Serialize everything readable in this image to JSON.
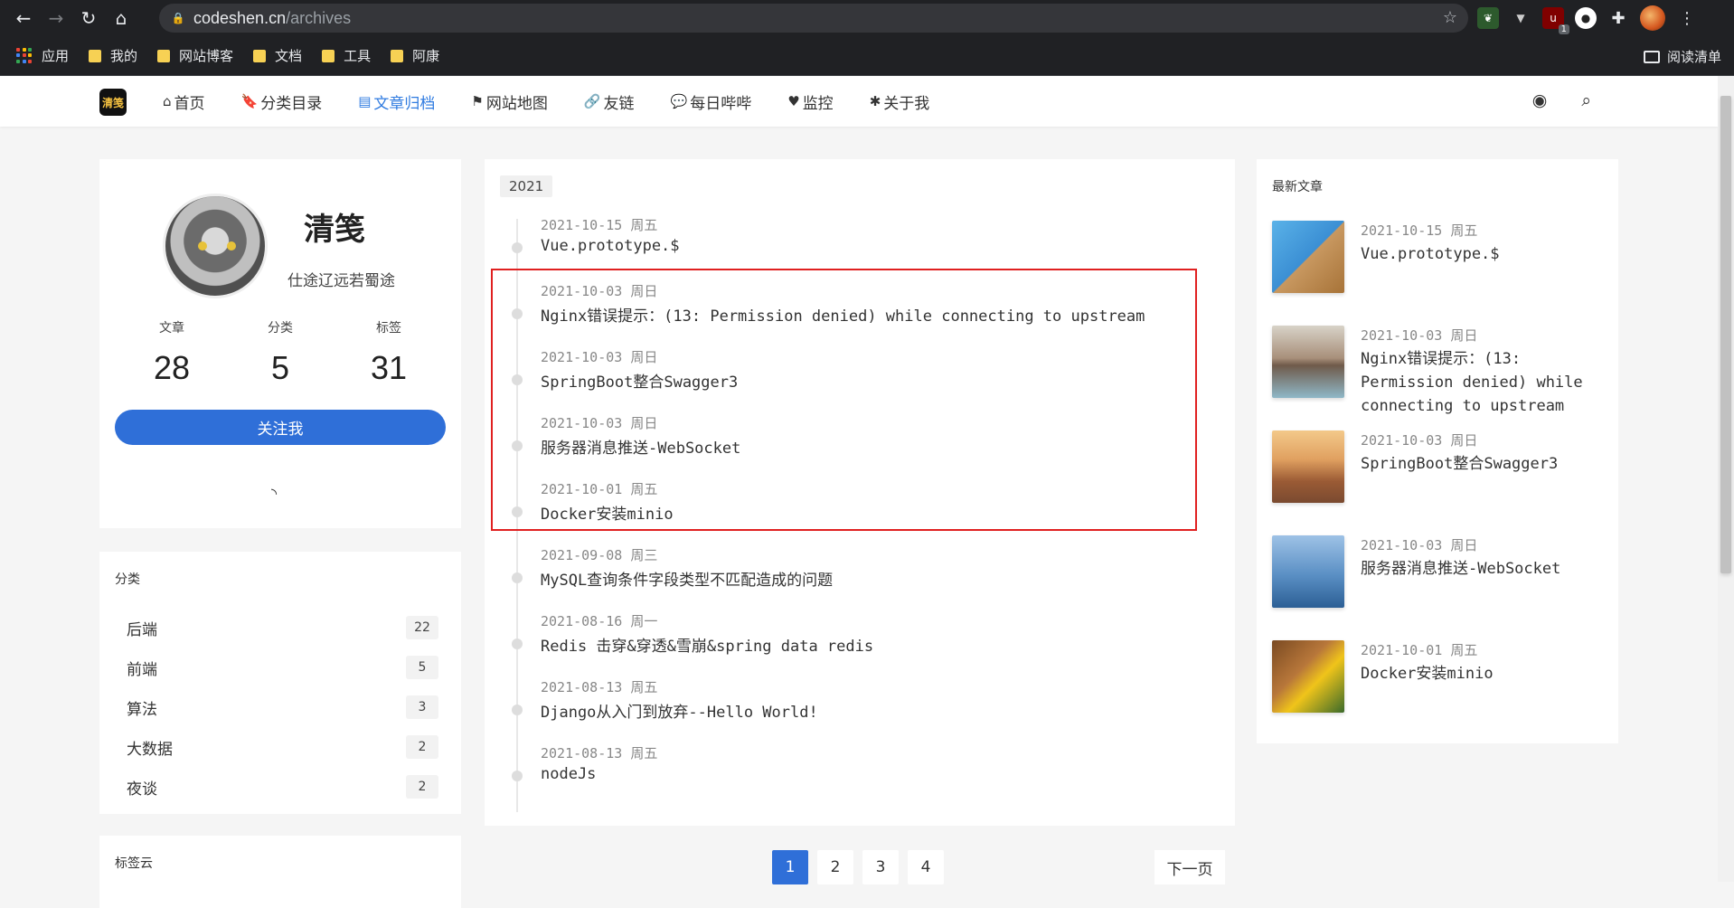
{
  "browser": {
    "url_host": "codeshen.cn",
    "url_path": "/archives",
    "bookmarks": [
      "应用",
      "我的",
      "网站博客",
      "文档",
      "工具",
      "阿康"
    ],
    "reading_list": "阅读清单",
    "ext_badge": "1"
  },
  "site": {
    "logo_text": "清笺",
    "menu": [
      {
        "icon": "⌂",
        "label": "首页"
      },
      {
        "icon": "🔖",
        "label": "分类目录"
      },
      {
        "icon": "▤",
        "label": "文章归档"
      },
      {
        "icon": "⚑",
        "label": "网站地图"
      },
      {
        "icon": "🔗",
        "label": "友链"
      },
      {
        "icon": "💬",
        "label": "每日哔哔"
      },
      {
        "icon": "♥",
        "label": "监控"
      },
      {
        "icon": "✱",
        "label": "关于我"
      }
    ],
    "active_menu": "文章归档"
  },
  "profile": {
    "name": "清笺",
    "motto": "仕途辽远若蜀途",
    "stats": [
      {
        "label": "文章",
        "value": "28"
      },
      {
        "label": "分类",
        "value": "5"
      },
      {
        "label": "标签",
        "value": "31"
      }
    ],
    "follow_label": "关注我"
  },
  "categories": {
    "title": "分类",
    "items": [
      {
        "name": "后端",
        "count": "22"
      },
      {
        "name": "前端",
        "count": "5"
      },
      {
        "name": "算法",
        "count": "3"
      },
      {
        "name": "大数据",
        "count": "2"
      },
      {
        "name": "夜谈",
        "count": "2"
      }
    ]
  },
  "tag_cloud": {
    "title": "标签云"
  },
  "archive": {
    "year": "2021",
    "items": [
      {
        "date": "2021-10-15 周五",
        "title": "Vue.prototype.$"
      },
      {
        "date": "2021-10-03 周日",
        "title": "Nginx错误提示：(13: Permission denied) while connecting to upstream"
      },
      {
        "date": "2021-10-03 周日",
        "title": "SpringBoot整合Swagger3"
      },
      {
        "date": "2021-10-03 周日",
        "title": "服务器消息推送-WebSocket"
      },
      {
        "date": "2021-10-01 周五",
        "title": "Docker安装minio"
      },
      {
        "date": "2021-09-08 周三",
        "title": "MySQL查询条件字段类型不匹配造成的问题"
      },
      {
        "date": "2021-08-16 周一",
        "title": "Redis 击穿&穿透&雪崩&spring data redis"
      },
      {
        "date": "2021-08-13 周五",
        "title": "Django从入门到放弃--Hello World!"
      },
      {
        "date": "2021-08-13 周五",
        "title": "nodeJs"
      }
    ]
  },
  "pagination": {
    "pages": [
      "1",
      "2",
      "3",
      "4"
    ],
    "current": "1",
    "next_label": "下一页"
  },
  "latest": {
    "title": "最新文章",
    "items": [
      {
        "date": "2021-10-15 周五",
        "title": "Vue.prototype.$"
      },
      {
        "date": "2021-10-03 周日",
        "title": "Nginx错误提示：(13: Permission denied) while connecting to upstream"
      },
      {
        "date": "2021-10-03 周日",
        "title": "SpringBoot整合Swagger3"
      },
      {
        "date": "2021-10-03 周日",
        "title": "服务器消息推送-WebSocket"
      },
      {
        "date": "2021-10-01 周五",
        "title": "Docker安装minio"
      }
    ]
  }
}
